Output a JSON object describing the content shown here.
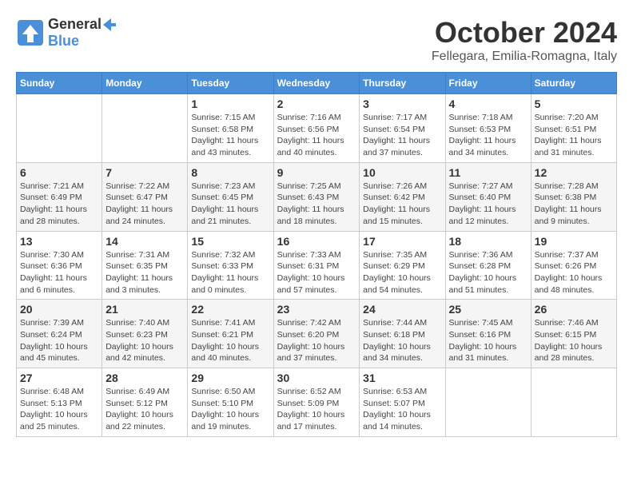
{
  "header": {
    "logo_general": "General",
    "logo_blue": "Blue",
    "month": "October 2024",
    "location": "Fellegara, Emilia-Romagna, Italy"
  },
  "weekdays": [
    "Sunday",
    "Monday",
    "Tuesday",
    "Wednesday",
    "Thursday",
    "Friday",
    "Saturday"
  ],
  "weeks": [
    [
      {
        "day": "",
        "info": ""
      },
      {
        "day": "",
        "info": ""
      },
      {
        "day": "1",
        "info": "Sunrise: 7:15 AM\nSunset: 6:58 PM\nDaylight: 11 hours and 43 minutes."
      },
      {
        "day": "2",
        "info": "Sunrise: 7:16 AM\nSunset: 6:56 PM\nDaylight: 11 hours and 40 minutes."
      },
      {
        "day": "3",
        "info": "Sunrise: 7:17 AM\nSunset: 6:54 PM\nDaylight: 11 hours and 37 minutes."
      },
      {
        "day": "4",
        "info": "Sunrise: 7:18 AM\nSunset: 6:53 PM\nDaylight: 11 hours and 34 minutes."
      },
      {
        "day": "5",
        "info": "Sunrise: 7:20 AM\nSunset: 6:51 PM\nDaylight: 11 hours and 31 minutes."
      }
    ],
    [
      {
        "day": "6",
        "info": "Sunrise: 7:21 AM\nSunset: 6:49 PM\nDaylight: 11 hours and 28 minutes."
      },
      {
        "day": "7",
        "info": "Sunrise: 7:22 AM\nSunset: 6:47 PM\nDaylight: 11 hours and 24 minutes."
      },
      {
        "day": "8",
        "info": "Sunrise: 7:23 AM\nSunset: 6:45 PM\nDaylight: 11 hours and 21 minutes."
      },
      {
        "day": "9",
        "info": "Sunrise: 7:25 AM\nSunset: 6:43 PM\nDaylight: 11 hours and 18 minutes."
      },
      {
        "day": "10",
        "info": "Sunrise: 7:26 AM\nSunset: 6:42 PM\nDaylight: 11 hours and 15 minutes."
      },
      {
        "day": "11",
        "info": "Sunrise: 7:27 AM\nSunset: 6:40 PM\nDaylight: 11 hours and 12 minutes."
      },
      {
        "day": "12",
        "info": "Sunrise: 7:28 AM\nSunset: 6:38 PM\nDaylight: 11 hours and 9 minutes."
      }
    ],
    [
      {
        "day": "13",
        "info": "Sunrise: 7:30 AM\nSunset: 6:36 PM\nDaylight: 11 hours and 6 minutes."
      },
      {
        "day": "14",
        "info": "Sunrise: 7:31 AM\nSunset: 6:35 PM\nDaylight: 11 hours and 3 minutes."
      },
      {
        "day": "15",
        "info": "Sunrise: 7:32 AM\nSunset: 6:33 PM\nDaylight: 11 hours and 0 minutes."
      },
      {
        "day": "16",
        "info": "Sunrise: 7:33 AM\nSunset: 6:31 PM\nDaylight: 10 hours and 57 minutes."
      },
      {
        "day": "17",
        "info": "Sunrise: 7:35 AM\nSunset: 6:29 PM\nDaylight: 10 hours and 54 minutes."
      },
      {
        "day": "18",
        "info": "Sunrise: 7:36 AM\nSunset: 6:28 PM\nDaylight: 10 hours and 51 minutes."
      },
      {
        "day": "19",
        "info": "Sunrise: 7:37 AM\nSunset: 6:26 PM\nDaylight: 10 hours and 48 minutes."
      }
    ],
    [
      {
        "day": "20",
        "info": "Sunrise: 7:39 AM\nSunset: 6:24 PM\nDaylight: 10 hours and 45 minutes."
      },
      {
        "day": "21",
        "info": "Sunrise: 7:40 AM\nSunset: 6:23 PM\nDaylight: 10 hours and 42 minutes."
      },
      {
        "day": "22",
        "info": "Sunrise: 7:41 AM\nSunset: 6:21 PM\nDaylight: 10 hours and 40 minutes."
      },
      {
        "day": "23",
        "info": "Sunrise: 7:42 AM\nSunset: 6:20 PM\nDaylight: 10 hours and 37 minutes."
      },
      {
        "day": "24",
        "info": "Sunrise: 7:44 AM\nSunset: 6:18 PM\nDaylight: 10 hours and 34 minutes."
      },
      {
        "day": "25",
        "info": "Sunrise: 7:45 AM\nSunset: 6:16 PM\nDaylight: 10 hours and 31 minutes."
      },
      {
        "day": "26",
        "info": "Sunrise: 7:46 AM\nSunset: 6:15 PM\nDaylight: 10 hours and 28 minutes."
      }
    ],
    [
      {
        "day": "27",
        "info": "Sunrise: 6:48 AM\nSunset: 5:13 PM\nDaylight: 10 hours and 25 minutes."
      },
      {
        "day": "28",
        "info": "Sunrise: 6:49 AM\nSunset: 5:12 PM\nDaylight: 10 hours and 22 minutes."
      },
      {
        "day": "29",
        "info": "Sunrise: 6:50 AM\nSunset: 5:10 PM\nDaylight: 10 hours and 19 minutes."
      },
      {
        "day": "30",
        "info": "Sunrise: 6:52 AM\nSunset: 5:09 PM\nDaylight: 10 hours and 17 minutes."
      },
      {
        "day": "31",
        "info": "Sunrise: 6:53 AM\nSunset: 5:07 PM\nDaylight: 10 hours and 14 minutes."
      },
      {
        "day": "",
        "info": ""
      },
      {
        "day": "",
        "info": ""
      }
    ]
  ]
}
